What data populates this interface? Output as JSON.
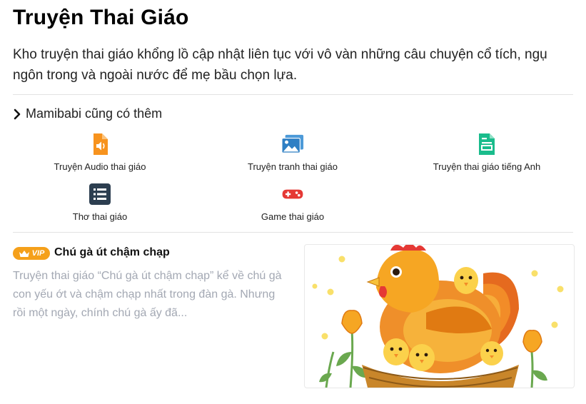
{
  "page": {
    "title": "Truyện Thai Giáo",
    "intro": "Kho truyện thai giáo khổng lồ cập nhật liên tục với vô vàn những câu chuyện cổ tích, ngụ ngôn trong và ngoài nước để mẹ bầu chọn lựa."
  },
  "more_section": {
    "title": "Mamibabi cũng có thêm",
    "items": [
      {
        "label": "Truyện Audio thai giáo",
        "icon": "audio-file-icon",
        "color": "#f7931e"
      },
      {
        "label": "Truyện tranh thai giáo",
        "icon": "images-icon",
        "color": "#2e7fc4"
      },
      {
        "label": "Truyện thai giáo tiếng Anh",
        "icon": "document-icon",
        "color": "#1abc8c"
      },
      {
        "label": "Thơ thai giáo",
        "icon": "list-icon",
        "color": "#2c3e50"
      },
      {
        "label": "Game thai giáo",
        "icon": "gamepad-icon",
        "color": "#e53935"
      }
    ]
  },
  "story": {
    "badge": "VIP",
    "badge_color": "#f5a01a",
    "title": "Chú gà út chậm chạp",
    "description": "Truyện thai giáo “Chú gà út chậm chạp” kể về chú gà con yếu ớt và chậm chạp nhất trong đàn gà. Nhưng rồi một ngày, chính chú gà ấy đã...",
    "image": "hen-with-chicks-illustration"
  }
}
